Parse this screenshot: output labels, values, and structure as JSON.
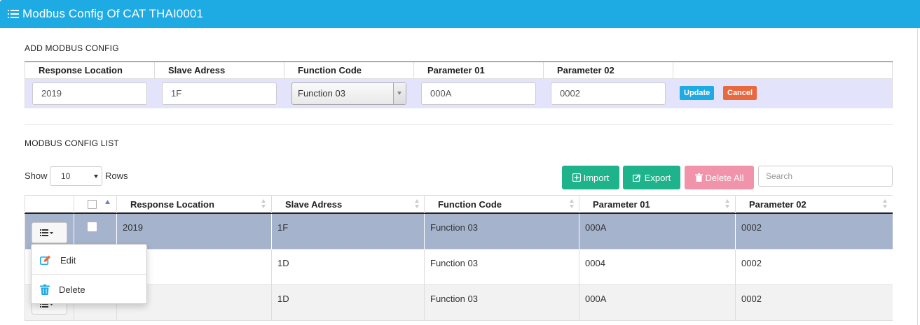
{
  "header": {
    "title": "Modbus Config Of CAT THAI0001",
    "icon": "list-icon",
    "color": "#1eaae3"
  },
  "add_section": {
    "title": "ADD MODBUS CONFIG",
    "columns": [
      "Response Location",
      "Slave Adress",
      "Function Code",
      "Parameter 01",
      "Parameter 02"
    ],
    "values": {
      "response_location": "2019",
      "slave_address": "1F",
      "function_code": "Function 03",
      "parameter_01": "000A",
      "parameter_02": "0002"
    },
    "update_label": "Update",
    "cancel_label": "Cancel",
    "update_color": "#1eaae3",
    "cancel_color": "#e8693f"
  },
  "list_section": {
    "title": "MODBUS CONFIG LIST",
    "show_label": "Show",
    "rows_per_page": "10",
    "rows_label": "Rows",
    "import_label": "Import",
    "export_label": "Export",
    "delete_all_label": "Delete All",
    "search_placeholder": "Search",
    "import_color": "#1eb38a",
    "delete_all_color": "#f093ab",
    "columns": [
      "Response Location",
      "Slave Adress",
      "Function Code",
      "Parameter 01",
      "Parameter 02"
    ],
    "rows": [
      {
        "response_location": "2019",
        "slave_address": "1F",
        "function_code": "Function 03",
        "parameter_01": "000A",
        "parameter_02": "0002"
      },
      {
        "response_location": "",
        "slave_address": "1D",
        "function_code": "Function 03",
        "parameter_01": "0004",
        "parameter_02": "0002"
      },
      {
        "response_location": "",
        "slave_address": "1D",
        "function_code": "Function 03",
        "parameter_01": "000A",
        "parameter_02": "0002"
      }
    ],
    "row_menu": {
      "edit_label": "Edit",
      "delete_label": "Delete"
    }
  }
}
